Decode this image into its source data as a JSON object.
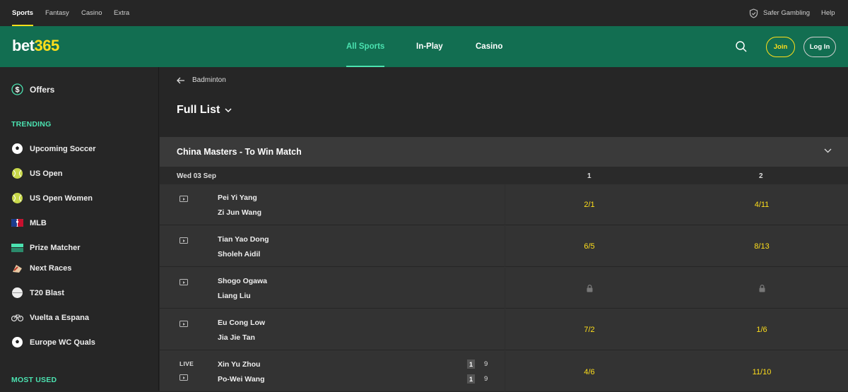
{
  "topbar": {
    "sports": "Sports",
    "fantasy": "Fantasy",
    "casino": "Casino",
    "extra": "Extra",
    "safer_gambling": "Safer Gambling",
    "help": "Help"
  },
  "header": {
    "logo_main": "bet",
    "logo_num": "365",
    "nav": {
      "all_sports": "All Sports",
      "in_play": "In-Play",
      "casino": "Casino"
    },
    "join": "Join",
    "login": "Log In"
  },
  "sidebar": {
    "offers": "Offers",
    "trending_heading": "TRENDING",
    "items": [
      {
        "label": "Upcoming Soccer",
        "icon": "soccer-ball-icon"
      },
      {
        "label": "US Open",
        "icon": "tennis-ball-icon"
      },
      {
        "label": "US Open Women",
        "icon": "tennis-ball-icon"
      },
      {
        "label": "MLB",
        "icon": "mlb-logo-icon"
      },
      {
        "label": "Prize Matcher",
        "icon": "prize-matcher-icon"
      },
      {
        "label": "Next Races",
        "icon": "horse-racing-icon"
      },
      {
        "label": "T20 Blast",
        "icon": "cricket-ball-icon"
      },
      {
        "label": "Vuelta a Espana",
        "icon": "bicycle-icon"
      },
      {
        "label": "Europe WC Quals",
        "icon": "soccer-ball-icon"
      }
    ],
    "most_used_heading": "MOST USED"
  },
  "main": {
    "breadcrumb": "Badminton",
    "view_selector": "Full List",
    "competition": "China Masters - To Win Match",
    "day": "Wed 03 Sep",
    "col1": "1",
    "col2": "2",
    "matches": [
      {
        "p1": "Pei Yi Yang",
        "p2": "Zi Jun Wang",
        "odd1": "2/1",
        "odd2": "4/11",
        "locked": false,
        "live": false
      },
      {
        "p1": "Tian Yao Dong",
        "p2": "Sholeh Aidil",
        "odd1": "6/5",
        "odd2": "8/13",
        "locked": false,
        "live": false
      },
      {
        "p1": "Shogo Ogawa",
        "p2": "Liang Liu",
        "odd1": "",
        "odd2": "",
        "locked": true,
        "live": false
      },
      {
        "p1": "Eu Cong Low",
        "p2": "Jia Jie Tan",
        "odd1": "7/2",
        "odd2": "1/6",
        "locked": false,
        "live": false
      },
      {
        "p1": "Xin Yu Zhou",
        "p2": "Po-Wei Wang",
        "odd1": "4/6",
        "odd2": "11/10",
        "locked": false,
        "live": true,
        "live_label": "LIVE",
        "set1": "1",
        "set2": "1",
        "pts1": "9",
        "pts2": "9"
      }
    ]
  },
  "colors": {
    "brand_green": "#126e51",
    "accent_yellow": "#ffdf1b",
    "accent_teal": "#4be2b0"
  }
}
